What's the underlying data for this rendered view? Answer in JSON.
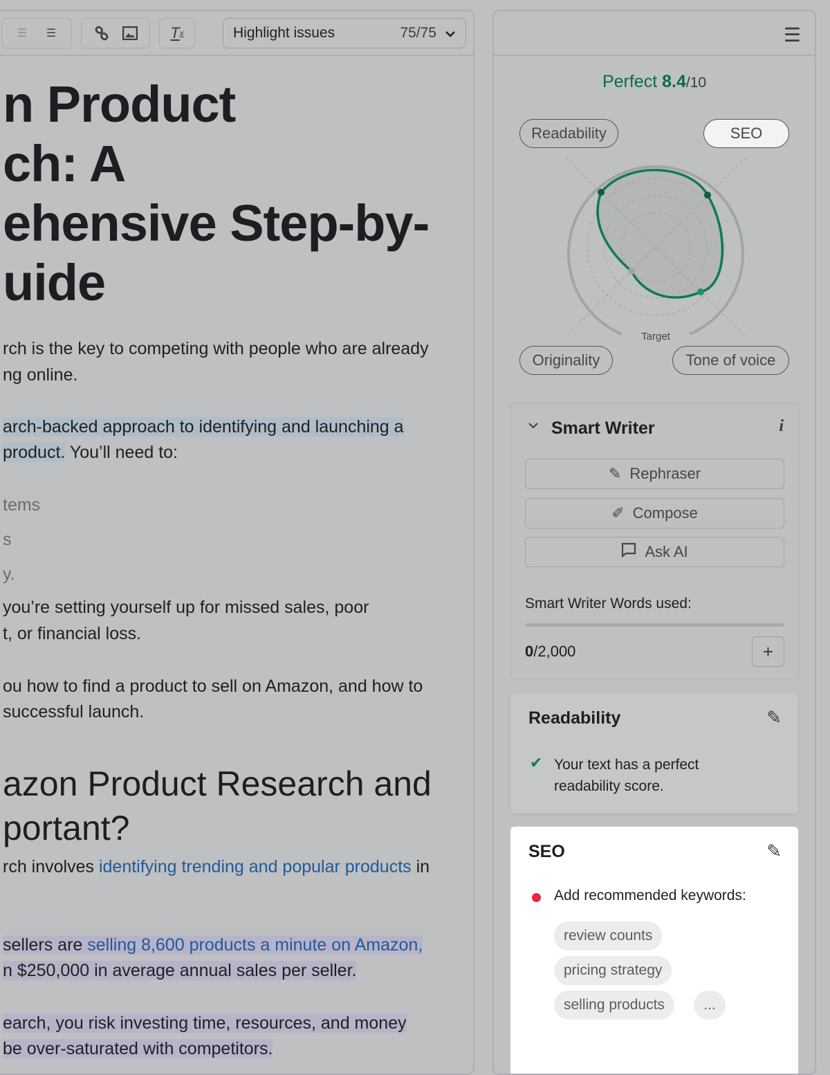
{
  "toolbar": {
    "highlight_label": "Highlight issues",
    "highlight_count": "75/75",
    "icons": [
      "ordered-list-icon",
      "bullet-list-icon",
      "link-icon",
      "image-icon",
      "clear-format-icon",
      "chevron-down-icon"
    ]
  },
  "document": {
    "title_lines": [
      "n Product",
      "ch: A",
      "ehensive Step-by-",
      "uide"
    ],
    "p1": [
      "rch is the key to competing with people who are already",
      "ng online."
    ],
    "p2a": "arch-backed approach to identifying and launching a",
    "p2b": "product.",
    "p2c": " You’ll need to:",
    "list": [
      "tems",
      "s",
      "y."
    ],
    "p3": [
      "you’re setting yourself up for missed sales, poor",
      "t, or financial loss."
    ],
    "p4": [
      "ou how to find a product to sell on Amazon, and how to",
      "successful launch."
    ],
    "h2": [
      "azon Product Research and",
      "portant?"
    ],
    "p5a": "rch involves ",
    "p5link": "identifying trending and popular products",
    "p5b": " in",
    "p6a": " sellers are ",
    "p6link": "selling 8,600 products a minute on Amazon,",
    "p6b": "n $250,000 in average annual sales per seller.",
    "p7a": "earch, you risk investing time, resources, and money",
    "p7b": "be over-saturated with competitors."
  },
  "score": {
    "label": "Perfect",
    "value": "8.4",
    "max": "/10",
    "color": "#0b6b4e"
  },
  "radar": {
    "axes": [
      "Readability",
      "SEO",
      "Originality",
      "Tone of voice"
    ],
    "active_axis": "SEO",
    "target_label": "Target"
  },
  "smart_writer": {
    "title": "Smart Writer",
    "buttons": [
      "Rephraser",
      "Compose",
      "Ask AI"
    ],
    "words_label": "Smart Writer Words used:",
    "used": "0",
    "limit": "/2,000",
    "progress": 0
  },
  "readability": {
    "title": "Readability",
    "message": "Your text has a perfect readability score."
  },
  "seo": {
    "title": "SEO",
    "message": "Add recommended keywords:",
    "keywords": [
      "review counts",
      "pricing strategy",
      "selling products"
    ],
    "more": "..."
  }
}
